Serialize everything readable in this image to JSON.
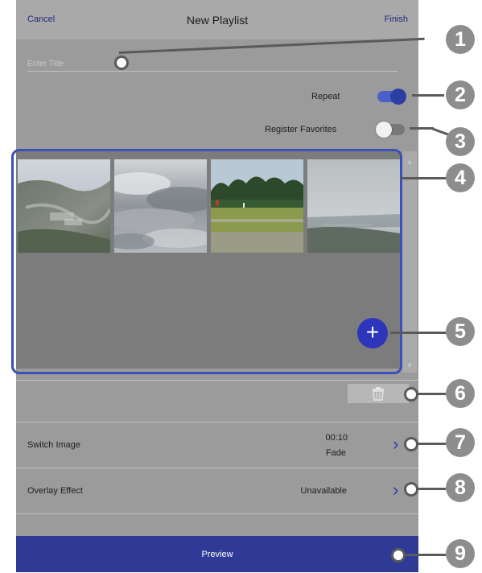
{
  "header": {
    "cancel_label": "Cancel",
    "title": "New Playlist",
    "finish_label": "Finish"
  },
  "title_field": {
    "placeholder": "Enter Title",
    "value": ""
  },
  "toggles": {
    "repeat": {
      "label": "Repeat",
      "on": true
    },
    "register_favorites": {
      "label": "Register Favorites",
      "on": false
    }
  },
  "media": {
    "thumbnails": [
      {
        "icon": "landscape-town-image"
      },
      {
        "icon": "cloudy-sky-image"
      },
      {
        "icon": "field-trees-image"
      },
      {
        "icon": "misty-coast-image"
      }
    ],
    "add_icon": "plus-icon",
    "delete_icon": "trash-icon"
  },
  "settings": {
    "switch_image": {
      "label": "Switch Image",
      "duration": "00:10",
      "transition": "Fade"
    },
    "overlay_effect": {
      "label": "Overlay Effect",
      "value": "Unavailable"
    }
  },
  "preview_label": "Preview",
  "callouts": [
    "1",
    "2",
    "3",
    "4",
    "5",
    "6",
    "7",
    "8",
    "9"
  ],
  "colors": {
    "accent": "#2d36ba",
    "preview_bar": "#2f3a96",
    "panel": "#9b9b9b"
  }
}
